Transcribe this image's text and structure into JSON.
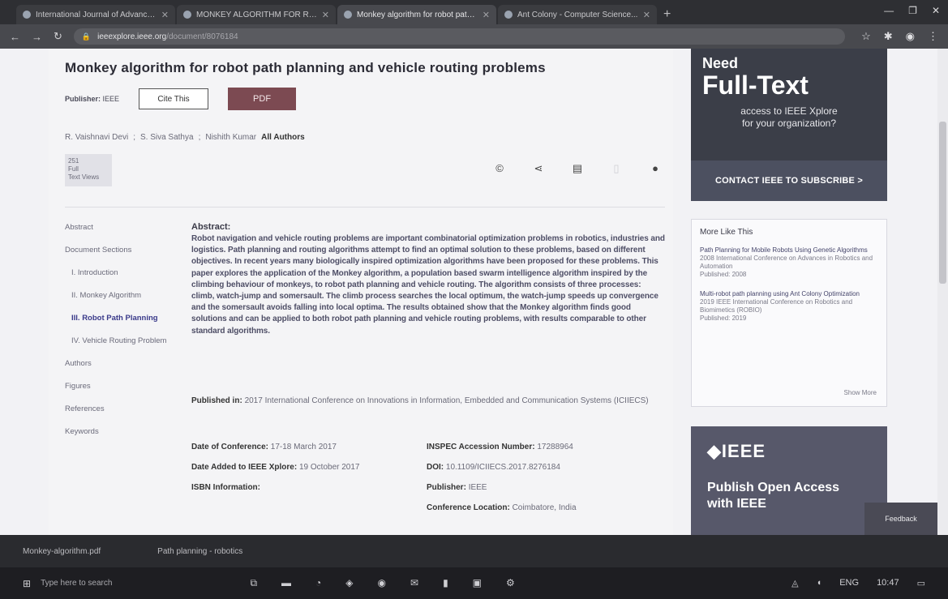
{
  "browser": {
    "tabs": [
      {
        "label": "International Journal of Advanced...",
        "active": false
      },
      {
        "label": "MONKEY ALGORITHM FOR ROBOT...",
        "active": false
      },
      {
        "label": "Monkey algorithm for robot path...",
        "active": true
      },
      {
        "label": "Ant Colony - Computer Science...",
        "active": false
      }
    ],
    "url_host": "ieeexplore.ieee.org",
    "url_path": "/document/8076184"
  },
  "paper": {
    "title": "Monkey algorithm for robot path planning and vehicle routing problems",
    "publisher_label": "Publisher:",
    "publisher_value": "IEEE",
    "cite_label": "Cite This",
    "pdf_label": "PDF",
    "authors": [
      "R. Vaishnavi Devi",
      "S. Siva Sathya",
      "Nishith Kumar"
    ],
    "all_authors_label": "All Authors",
    "metric_lines": [
      "251",
      "Full",
      "Text Views"
    ]
  },
  "sidenav": [
    {
      "label": "Abstract",
      "active": false,
      "sub": false
    },
    {
      "label": "Document Sections",
      "active": false,
      "sub": false
    },
    {
      "label": "I. Introduction",
      "active": false,
      "sub": true
    },
    {
      "label": "II. Monkey Algorithm",
      "active": false,
      "sub": true
    },
    {
      "label": "III. Robot Path Planning",
      "active": true,
      "sub": true
    },
    {
      "label": "IV. Vehicle Routing Problem",
      "active": false,
      "sub": true
    },
    {
      "label": "Authors",
      "active": false,
      "sub": false
    },
    {
      "label": "Figures",
      "active": false,
      "sub": false
    },
    {
      "label": "References",
      "active": false,
      "sub": false
    },
    {
      "label": "Keywords",
      "active": false,
      "sub": false
    }
  ],
  "abstract": {
    "heading": "Abstract:",
    "text": "Robot navigation and vehicle routing problems are important combinatorial optimization problems in robotics, industries and logistics. Path planning and routing algorithms attempt to find an optimal solution to these problems, based on different objectives. In recent years many biologically inspired optimization algorithms have been proposed for these problems. This paper explores the application of the Monkey algorithm, a population based swarm intelligence algorithm inspired by the climbing behaviour of monkeys, to robot path planning and vehicle routing. The algorithm consists of three processes: climb, watch-jump and somersault. The climb process searches the local optimum, the watch-jump speeds up convergence and the somersault avoids falling into local optima. The results obtained show that the Monkey algorithm finds good solutions and can be applied to both robot path planning and vehicle routing problems, with results comparable to other standard algorithms."
  },
  "published_in": {
    "label": "Published in:",
    "value": "2017 International Conference on Innovations in Information, Embedded and Communication Systems (ICIIECS)"
  },
  "details": {
    "date_conf_label": "Date of Conference:",
    "date_conf_value": "17-18 March 2017",
    "date_added_label": "Date Added to IEEE Xplore:",
    "date_added_value": "19 October 2017",
    "isbn_label": "ISBN Information:",
    "inspec_label": "INSPEC Accession Number:",
    "inspec_value": "17288964",
    "doi_label": "DOI:",
    "doi_value": "10.1109/ICIIECS.2017.8276184",
    "publisher_label": "Publisher:",
    "publisher_value": "IEEE",
    "location_label": "Conference Location:",
    "location_value": "Coimbatore, India"
  },
  "ad_fulltext": {
    "line1": "Need",
    "line2": "Full-Text",
    "line3": "access to IEEE Xplore",
    "line4": "for your organization?",
    "cta": "CONTACT IEEE TO SUBSCRIBE >"
  },
  "more_like_this": {
    "heading": "More Like This",
    "items": [
      {
        "title": "Path Planning for Mobile Robots Using Genetic Algorithms",
        "venue": "2008 International Conference on Advances in Robotics and Automation",
        "published": "Published: 2008"
      },
      {
        "title": "Multi-robot path planning using Ant Colony Optimization",
        "venue": "2019 IEEE International Conference on Robotics and Biomimetics (ROBIO)",
        "published": "Published: 2019"
      }
    ],
    "show_more": "Show More"
  },
  "ad_open_access": {
    "logo": "◆IEEE",
    "line1": "Publish Open Access",
    "line2": "with IEEE"
  },
  "feedback_label": "Feedback",
  "notification": {
    "left": "Monkey-algorithm.pdf",
    "right": "Path planning - robotics"
  },
  "taskbar": {
    "search_placeholder": "Type here to search",
    "time": "10:47",
    "date": "ENG"
  }
}
